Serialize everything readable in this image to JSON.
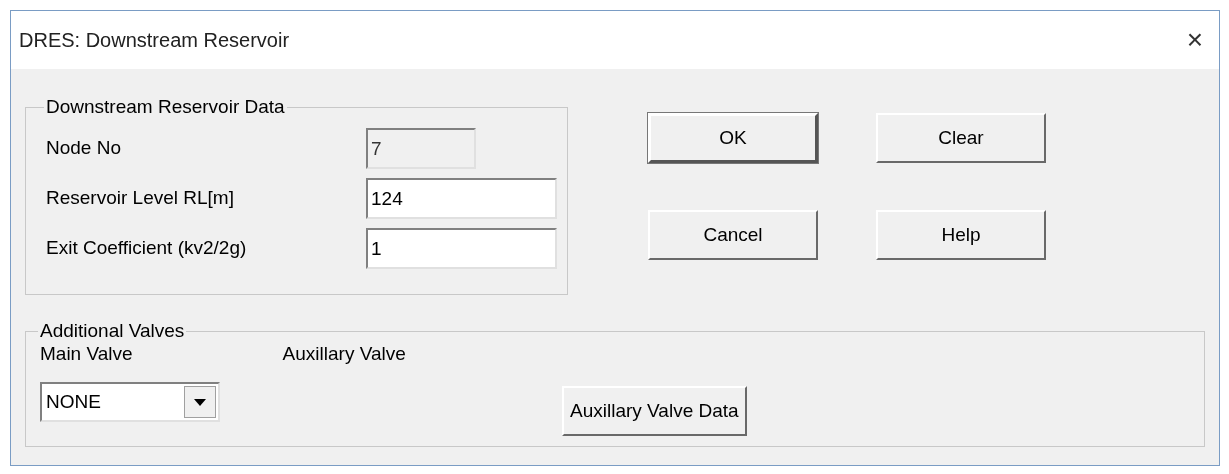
{
  "window": {
    "title": "DRES: Downstream Reservoir",
    "close": "×"
  },
  "reservoir_data": {
    "title": "Downstream Reservoir Data",
    "fields": [
      {
        "label": "Node No",
        "value": "7",
        "disabled": true
      },
      {
        "label": "Reservoir Level RL[m]",
        "value": "124",
        "disabled": false
      },
      {
        "label": "Exit Coefficient (kv2/2g)",
        "value": "1",
        "disabled": false
      }
    ]
  },
  "buttons": [
    {
      "label": "OK",
      "default": true
    },
    {
      "label": "Clear",
      "default": false
    },
    {
      "label": "Cancel",
      "default": false
    },
    {
      "label": "Help",
      "default": false
    }
  ],
  "additional_valves": {
    "title": "Additional Valves",
    "main_valve_label": "Main Valve",
    "auxillary_valve_label": "Auxillary Valve",
    "main_valve": {
      "value": "NONE"
    },
    "auxillary_button": "Auxillary Valve Data"
  }
}
